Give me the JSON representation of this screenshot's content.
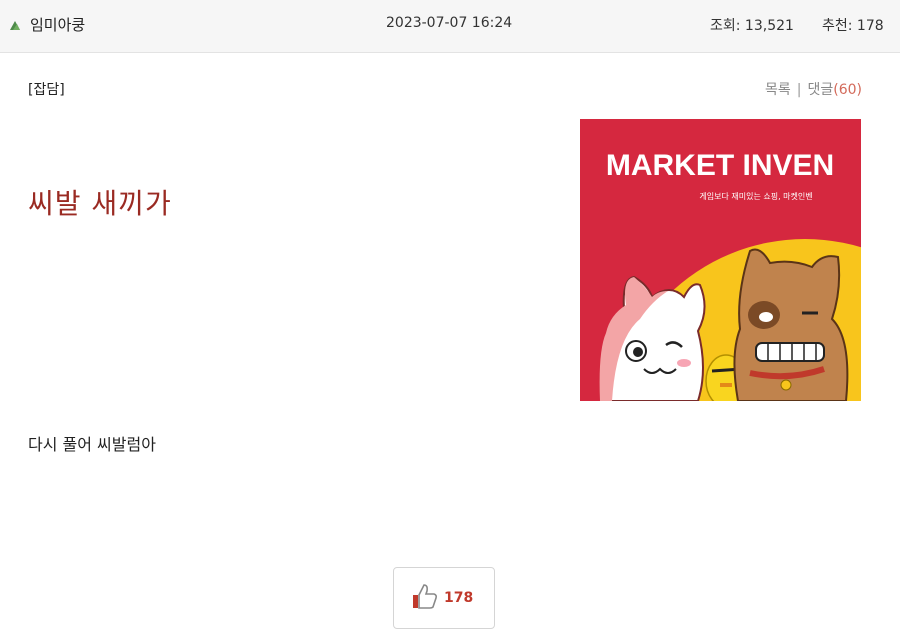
{
  "post": {
    "author": "임미아쿵",
    "date": "2023-07-07 16:24",
    "views_label": "조회: 13,521",
    "recommend_label": "추천: 178",
    "category": "[잡담]",
    "links": {
      "list": "목록",
      "comments": "댓글",
      "comment_count": "(60)"
    },
    "title": "씨발 새끼가",
    "body": "다시 풀어 씨발럼아",
    "recommend_count": "178"
  },
  "ad": {
    "brand": "MARKET INVEN",
    "tagline": "게임보다 재미있는 쇼핑, 마켓인벤",
    "colors": {
      "background": "#d5283f",
      "sun": "#f8c51c"
    }
  },
  "colors": {
    "title": "#9a2a22",
    "comment_count": "#d36a5a",
    "recommend": "#c0392b"
  }
}
